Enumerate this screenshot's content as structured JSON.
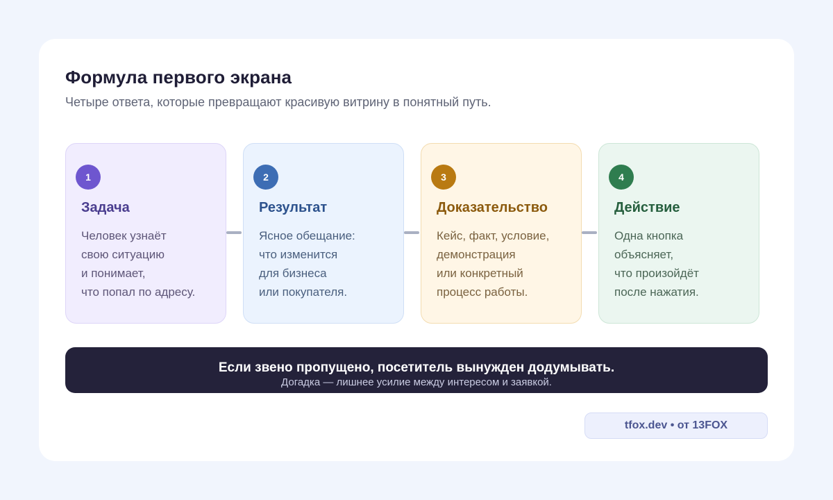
{
  "header": {
    "title": "Формула первого экрана",
    "subtitle": "Четыре ответа, которые превращают красивую витрину в понятный путь."
  },
  "steps": [
    {
      "number": "1",
      "title": "Задача",
      "lines": [
        "Человек узнаёт",
        "свою ситуацию",
        "и понимает,",
        "что попал по адресу."
      ],
      "accent": "#6e56cf"
    },
    {
      "number": "2",
      "title": "Результат",
      "lines": [
        "Ясное обещание:",
        "что изменится",
        "для бизнеса",
        "или покупателя."
      ],
      "accent": "#3d6db4"
    },
    {
      "number": "3",
      "title": "Доказательство",
      "lines": [
        "Кейс, факт, условие,",
        "демонстрация",
        "или конкретный",
        "процесс работы."
      ],
      "accent": "#b97a12"
    },
    {
      "number": "4",
      "title": "Действие",
      "lines": [
        "Одна кнопка",
        "объясняет,",
        "что произойдёт",
        "после нажатия."
      ],
      "accent": "#2f7d4f"
    }
  ],
  "banner": {
    "main": "Если звено пропущено, посетитель вынужден додумывать.",
    "sub": "Догадка — лишнее усилие между интересом и заявкой."
  },
  "credit": "tfox.dev • от 13FOX"
}
